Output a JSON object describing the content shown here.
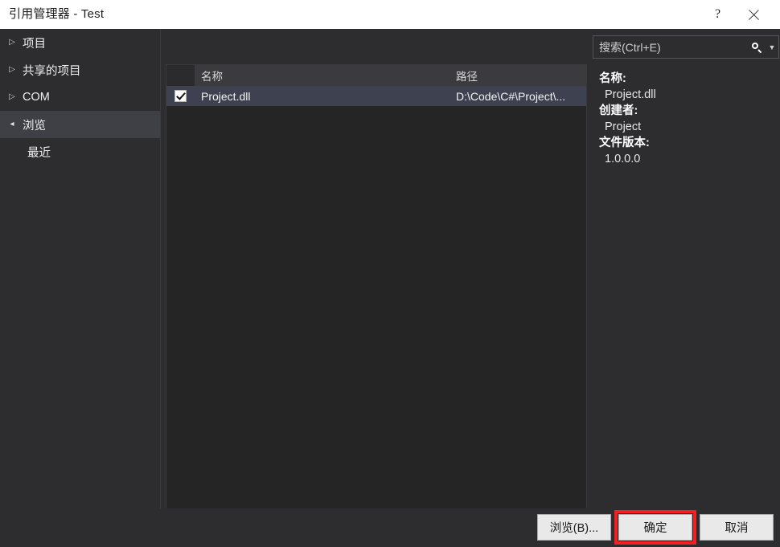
{
  "window": {
    "title": "引用管理器 - Test",
    "help_label": "?",
    "close_label": "×",
    "help_icon": "question-mark-icon",
    "close_icon": "close-icon"
  },
  "sidebar": {
    "items": [
      {
        "label": "项目",
        "arrow": "collapsed",
        "selected": false,
        "child": false
      },
      {
        "label": "共享的项目",
        "arrow": "collapsed",
        "selected": false,
        "child": false
      },
      {
        "label": "COM",
        "arrow": "collapsed",
        "selected": false,
        "child": false
      },
      {
        "label": "浏览",
        "arrow": "expanded",
        "selected": true,
        "child": false
      },
      {
        "label": "最近",
        "arrow": "none",
        "selected": false,
        "child": true
      }
    ]
  },
  "search": {
    "placeholder": "搜索(Ctrl+E)",
    "value": "",
    "icon": "search-icon",
    "dropdown_icon": "chevron-down-icon"
  },
  "list": {
    "columns": [
      {
        "key": "check",
        "label": ""
      },
      {
        "key": "name",
        "label": "名称"
      },
      {
        "key": "path",
        "label": "路径"
      }
    ],
    "rows": [
      {
        "checked": true,
        "name": "Project.dll",
        "path": "D:\\Code\\C#\\Project\\...",
        "selected": true
      }
    ]
  },
  "details": {
    "fields": [
      {
        "key": "名称:",
        "value": "Project.dll"
      },
      {
        "key": "创建者:",
        "value": "Project"
      },
      {
        "key": "文件版本:",
        "value": "1.0.0.0"
      }
    ]
  },
  "footer": {
    "browse_label": "浏览(B)...",
    "ok_label": "确定",
    "cancel_label": "取消",
    "highlighted_button": "确定"
  },
  "colors": {
    "dialog_bg": "#2d2d30",
    "list_bg": "#252526",
    "titlebar_bg": "#ffffff",
    "selection_bg": "#3e4250",
    "sidebar_selected_bg": "#3f3f46",
    "header_bg": "#3b3b3f",
    "button_bg": "#e9e9e9",
    "highlight_outline": "#f22020",
    "text_light": "#f0f0f0",
    "text_dark": "#1e1e1e"
  }
}
